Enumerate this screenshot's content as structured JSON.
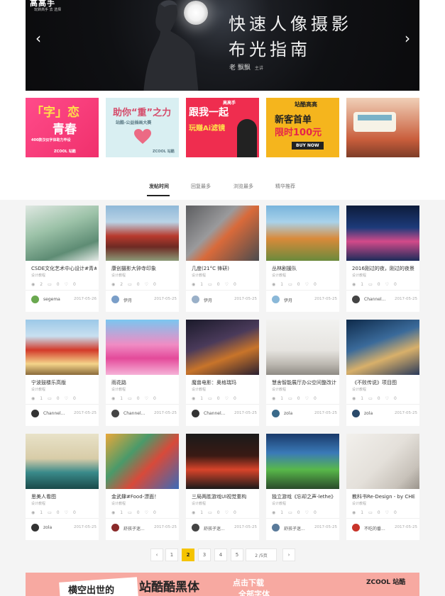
{
  "hero": {
    "logo": "高高手",
    "logo_sub": "玩转高手 去 选择",
    "title_line1": "快速人像摄影",
    "title_line2": "布光指南",
    "author": "老 飘飘",
    "author_role": "主讲"
  },
  "promos": [
    {
      "text1": "「字」恋",
      "text2": "青春",
      "text3": "400款汉仪字体助力毕设",
      "text4": "ZCOOL 站酷"
    },
    {
      "text1": "助你“重”之力",
      "text2": "站酷·公益插画大赛",
      "text3": "ZCOOL 站酷"
    },
    {
      "text1": "跟我一起",
      "text2": "玩赚Ai滤镜",
      "text3": "高高手"
    },
    {
      "text1": "站酷高高",
      "text2": "新客首单",
      "text3": "限时100元",
      "text4": "BUY NOW"
    },
    {
      "text1": ""
    }
  ],
  "tabs": [
    "发帖时间",
    "回复最多",
    "浏览最多",
    "精华推荐"
  ],
  "cards": [
    {
      "title": "CSDE文化艺术中心设计#青#",
      "sub": "设计教程",
      "views": "2",
      "comments": "0",
      "likes": "0",
      "user": "segema",
      "date": "2017-05-26"
    },
    {
      "title": "康创摄影大钟寺印象",
      "sub": "设计教程",
      "views": "2",
      "comments": "0",
      "likes": "0",
      "user": "伊月",
      "date": "2017-05-25"
    },
    {
      "title": "几度(21°C 锋研)",
      "sub": "设计教程",
      "views": "1",
      "comments": "0",
      "likes": "0",
      "user": "伊月",
      "date": "2017-05-25"
    },
    {
      "title": "丛林剧援队",
      "sub": "设计教程",
      "views": "1",
      "comments": "0",
      "likes": "0",
      "user": "伊月",
      "date": "2017-05-25"
    },
    {
      "title": "2016刚过的夜，刚过的夜景",
      "sub": "设计教程",
      "views": "1",
      "comments": "0",
      "likes": "0",
      "user": "Channel...",
      "date": "2017-05-25"
    },
    {
      "title": "宁波鼓楼乐高版",
      "sub": "设计教程",
      "views": "1",
      "comments": "0",
      "likes": "0",
      "user": "Channel...",
      "date": "2017-05-25"
    },
    {
      "title": "雨花路",
      "sub": "设计教程",
      "views": "1",
      "comments": "0",
      "likes": "0",
      "user": "Channel...",
      "date": "2017-05-25"
    },
    {
      "title": "魔兽电影：奥格瑞玛",
      "sub": "设计教程",
      "views": "1",
      "comments": "0",
      "likes": "0",
      "user": "Channel...",
      "date": "2017-05-25"
    },
    {
      "title": "慧舍智能展厅办公空间整改计",
      "sub": "设计教程",
      "views": "1",
      "comments": "0",
      "likes": "0",
      "user": "zola",
      "date": "2017-05-25"
    },
    {
      "title": "《不败传说》项目图",
      "sub": "设计教程",
      "views": "1",
      "comments": "0",
      "likes": "0",
      "user": "zola",
      "date": "2017-05-25"
    },
    {
      "title": "思美人看图",
      "sub": "设计教程",
      "views": "1",
      "comments": "0",
      "likes": "0",
      "user": "zola",
      "date": "2017-05-25"
    },
    {
      "title": "金武肆#Food-漂面！",
      "sub": "设计教程",
      "views": "1",
      "comments": "0",
      "likes": "0",
      "user": "舒孩子迷...",
      "date": "2017-05-25"
    },
    {
      "title": "三局两胜游戏UI视觉重构",
      "sub": "设计教程",
      "views": "1",
      "comments": "0",
      "likes": "0",
      "user": "舒孩子迷...",
      "date": "2017-05-25"
    },
    {
      "title": "独立游戏《忘却之声-lethe》",
      "sub": "设计教程",
      "views": "1",
      "comments": "0",
      "likes": "0",
      "user": "舒孩子迷...",
      "date": "2017-05-25"
    },
    {
      "title": "教科书Re-Design - by CHE",
      "sub": "设计教程",
      "views": "1",
      "comments": "0",
      "likes": "0",
      "user": "不吃的番...",
      "date": "2017-05-25"
    }
  ],
  "pagination": {
    "prev": "‹",
    "pages": [
      "1",
      "2",
      "3",
      "4",
      "5"
    ],
    "next": "›",
    "current": "2",
    "jump_text": "2  /5页"
  },
  "bottom_banner": {
    "text1": "横空出世的",
    "text2": "站酷酷黑体",
    "text3": "点击下载",
    "text4": "全部字体",
    "logo": "ZCOOL 站酷"
  },
  "colors": {
    "accent": "#f5c400",
    "background": "#f4f4f4"
  }
}
